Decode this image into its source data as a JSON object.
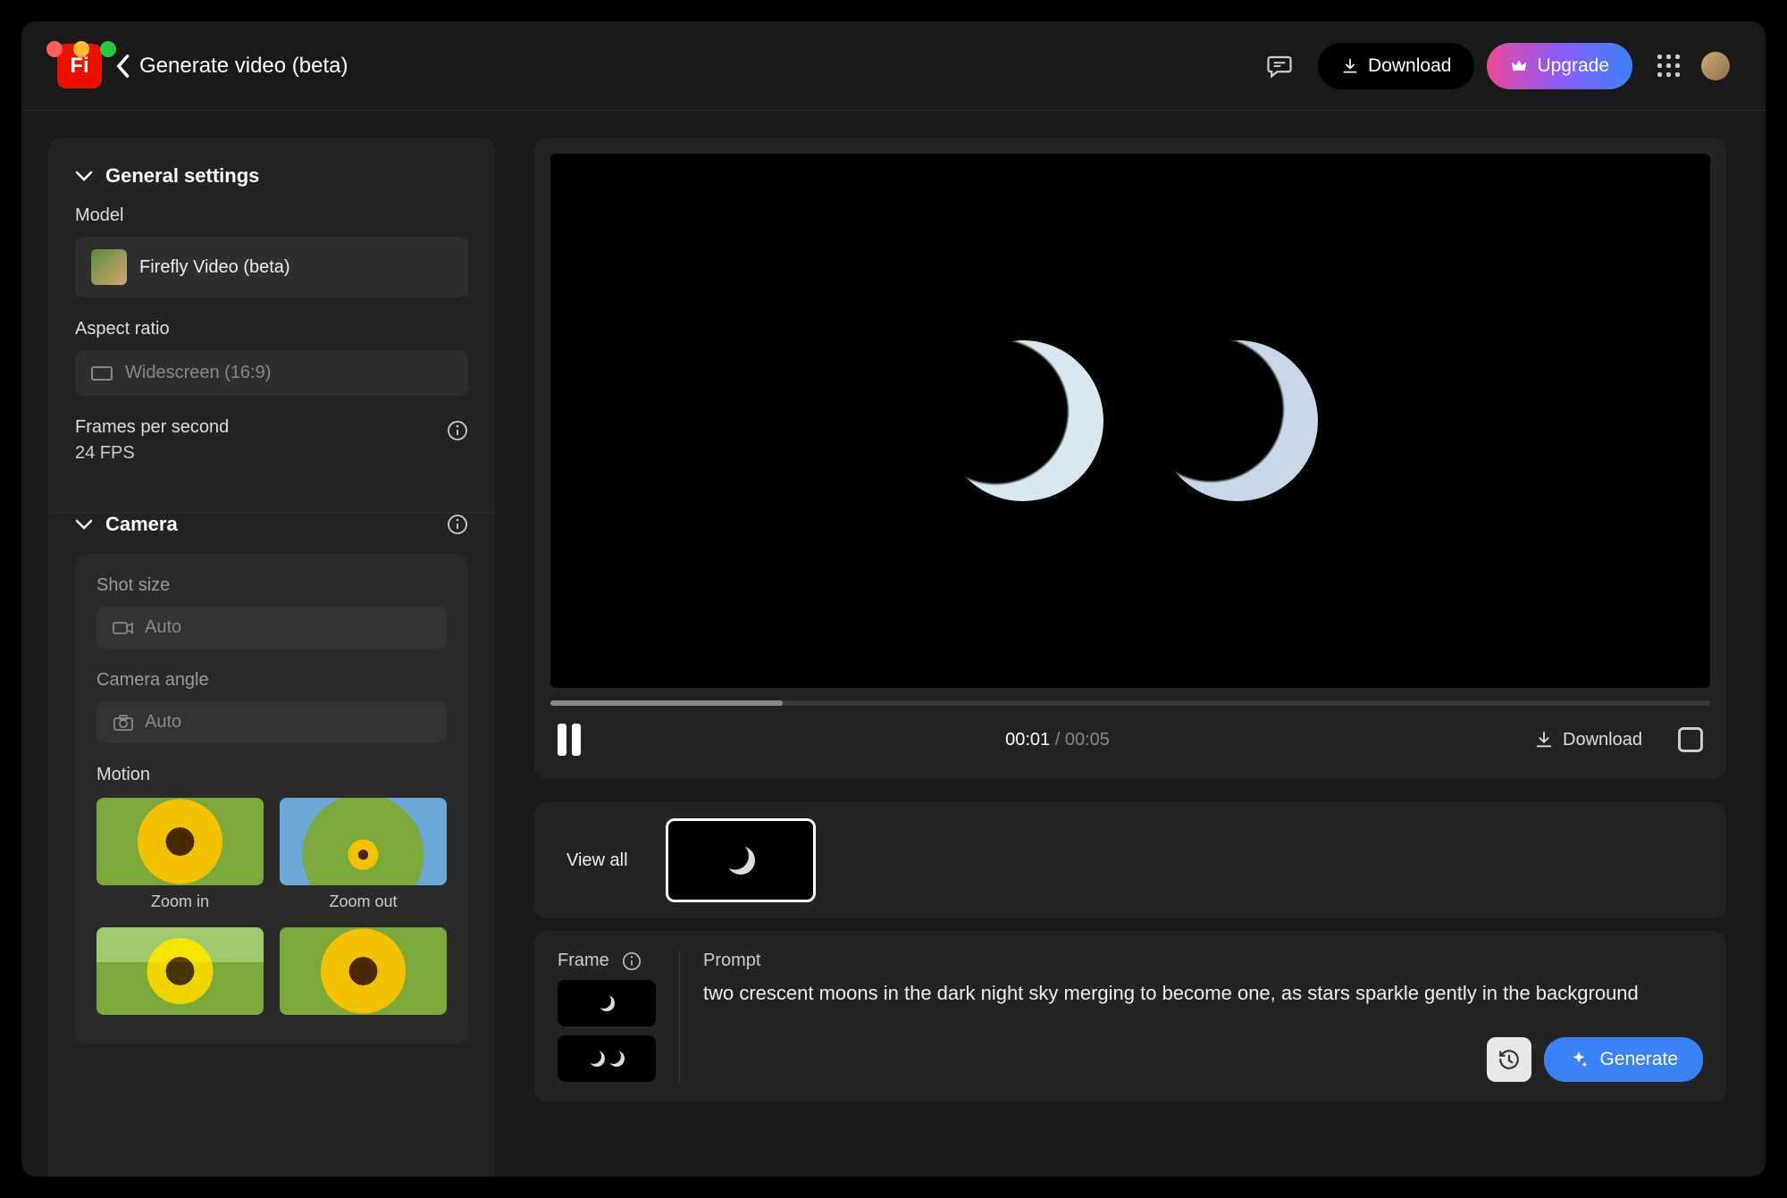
{
  "header": {
    "page_title": "Generate video (beta)",
    "download_label": "Download",
    "upgrade_label": "Upgrade"
  },
  "sidebar": {
    "general": {
      "title": "General settings",
      "model_label": "Model",
      "model_value": "Firefly Video (beta)",
      "aspect_label": "Aspect ratio",
      "aspect_value": "Widescreen (16:9)",
      "fps_label": "Frames per second",
      "fps_value": "24 FPS"
    },
    "camera": {
      "title": "Camera",
      "shot_size_label": "Shot size",
      "shot_size_value": "Auto",
      "camera_angle_label": "Camera angle",
      "camera_angle_value": "Auto",
      "motion_label": "Motion",
      "motion_options": [
        "Zoom in",
        "Zoom out"
      ]
    }
  },
  "player": {
    "time_current": "00:01",
    "time_sep": "/",
    "time_total": "00:05",
    "download_label": "Download"
  },
  "thumbs": {
    "view_all": "View all"
  },
  "prompt_panel": {
    "frame_label": "Frame",
    "prompt_label": "Prompt",
    "prompt_text": "two crescent moons in the dark night sky merging to become one, as stars sparkle gently in the background",
    "generate_label": "Generate"
  },
  "colors": {
    "accent_red": "#eb1000",
    "accent_blue": "#3b82f6"
  }
}
